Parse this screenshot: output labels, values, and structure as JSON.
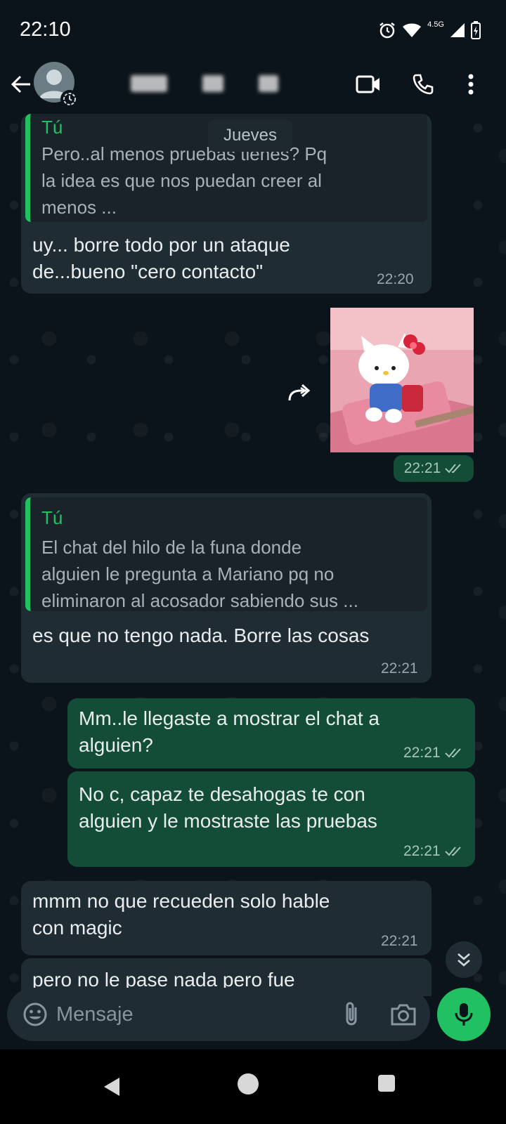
{
  "status_bar": {
    "time": "22:10",
    "network_label": "4.5G",
    "icons": [
      "alarm-icon",
      "wifi-icon",
      "signal-icon",
      "battery-icon"
    ]
  },
  "app_bar": {
    "icons": [
      "back-arrow-icon",
      "video-call-icon",
      "voice-call-icon",
      "more-vert-icon"
    ]
  },
  "chat": {
    "date_chip": "Jueves",
    "messages": [
      {
        "direction": "in",
        "quote": {
          "author": "Tú",
          "lines": [
            "Pero..al menos pruebas tienes? Pq",
            "la idea es que nos puedan creer al",
            "menos ..."
          ]
        },
        "lines": [
          "uy... borre todo por un ataque",
          "de...bueno \"cero contacto\""
        ],
        "time": "22:20"
      },
      {
        "direction": "out",
        "type": "sticker",
        "time": "22:21"
      },
      {
        "direction": "in",
        "quote": {
          "author": "Tú",
          "lines": [
            "El chat del hilo de la funa donde",
            "alguien le pregunta a Mariano pq no",
            "eliminaron al acosador sabiendo sus ..."
          ]
        },
        "lines": [
          "es que no tengo nada. Borre las cosas"
        ],
        "time": "22:21"
      },
      {
        "direction": "out",
        "lines": [
          "Mm..le llegaste a mostrar el chat a",
          "alguien?"
        ],
        "time": "22:21"
      },
      {
        "direction": "out",
        "lines": [
          "No c, capaz te desahogas te con",
          "alguien y le mostraste las pruebas"
        ],
        "time": "22:21"
      },
      {
        "direction": "in",
        "lines": [
          "mmm no que recueden solo hable",
          "con magic"
        ],
        "time": "22:21"
      },
      {
        "direction": "in",
        "lines": [
          "pero no le pase nada  pero fue"
        ]
      }
    ]
  },
  "composer": {
    "placeholder": "Mensaje",
    "icons": [
      "emoji-icon",
      "attach-icon",
      "camera-icon",
      "mic-icon"
    ]
  },
  "colors": {
    "background": "#0b141a",
    "incoming_bubble": "#202c33",
    "outgoing_bubble": "#134d37",
    "accent": "#21c063"
  }
}
